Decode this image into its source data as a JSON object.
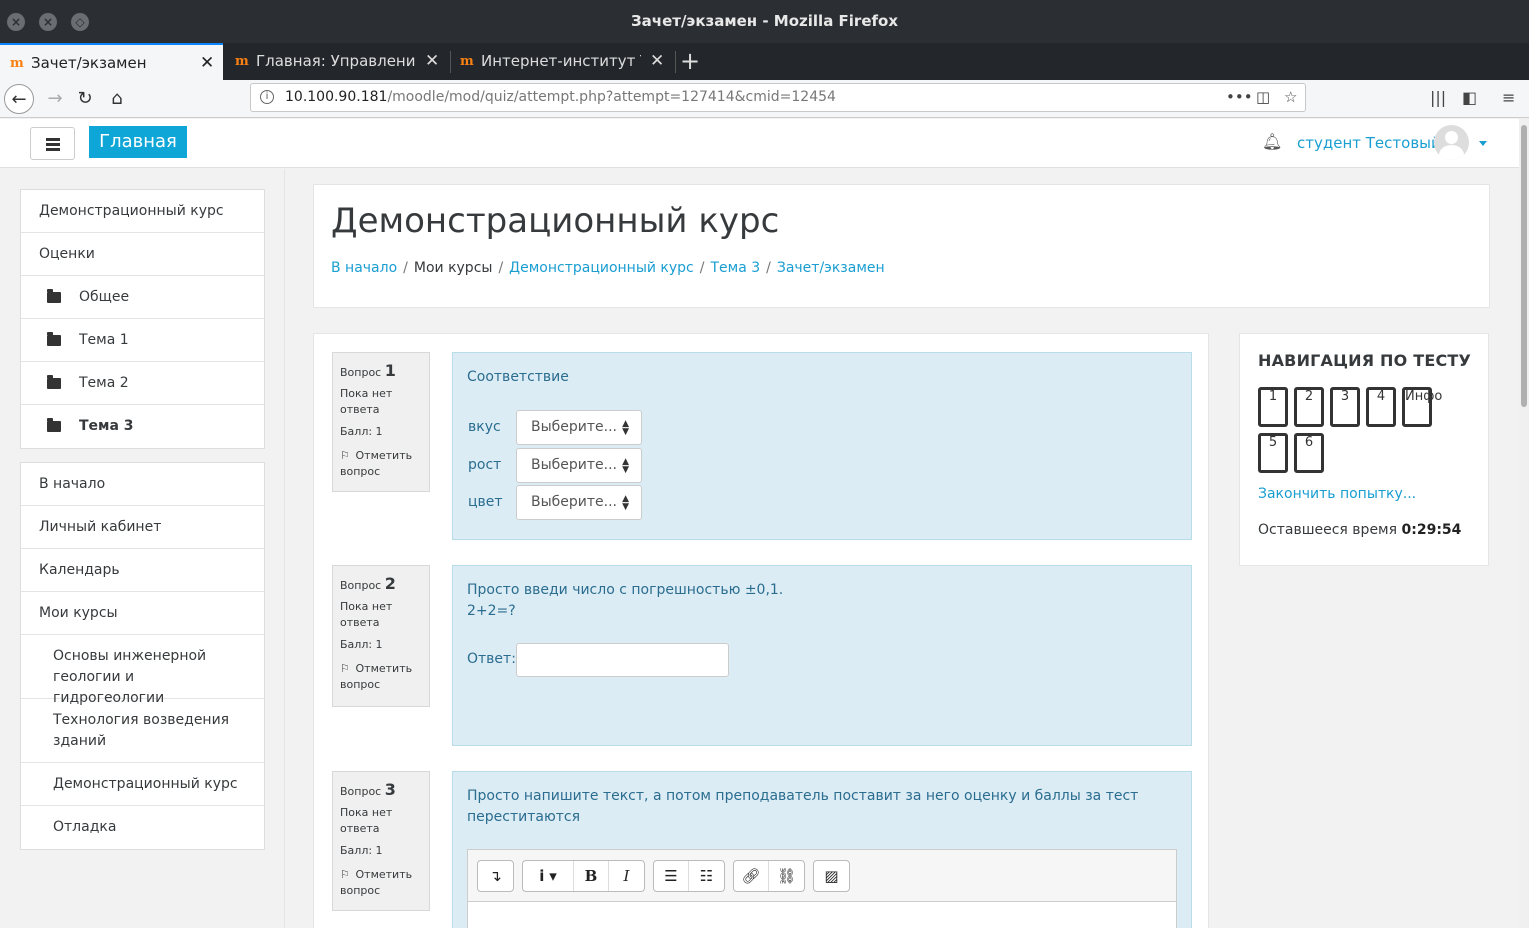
{
  "window": {
    "title": "Зачет/экзамен - Mozilla Firefox"
  },
  "tabs": [
    {
      "label": "Зачет/экзамен",
      "active": true
    },
    {
      "label": "Главная: Управление",
      "active": false
    },
    {
      "label": "Интернет-институт Ту",
      "active": false
    }
  ],
  "address": {
    "host": "10.100.90.181",
    "path": "/moodle/mod/quiz/attempt.php?attempt=127414&cmid=12454"
  },
  "header": {
    "home_label": "Главная",
    "user_name": "студент Тестовый"
  },
  "drawer": {
    "course_items": [
      {
        "label": "Демонстрационный курс"
      },
      {
        "label": "Оценки"
      },
      {
        "label": "Общее"
      },
      {
        "label": "Тема 1"
      },
      {
        "label": "Тема 2"
      },
      {
        "label": "Тема 3"
      }
    ],
    "site_items": [
      {
        "label": "В начало"
      },
      {
        "label": "Личный кабинет"
      },
      {
        "label": "Календарь"
      },
      {
        "label": "Мои курсы"
      },
      {
        "label": "Основы инженерной геологии и гидрогеологии"
      },
      {
        "label": "Технология возведения зданий"
      },
      {
        "label": "Демонстрационный курс"
      },
      {
        "label": "Отладка"
      }
    ]
  },
  "course": {
    "title": "Демонстрационный курс",
    "breadcrumb": [
      {
        "label": "В начало"
      },
      {
        "label": "Мои курсы"
      },
      {
        "label": "Демонстрационный курс"
      },
      {
        "label": "Тема 3"
      },
      {
        "label": "Зачет/экзамен"
      }
    ]
  },
  "questions": [
    {
      "label": "Вопрос",
      "number": "1",
      "status_line1": "Пока нет",
      "status_line2": "ответа",
      "grade": "Балл: 1",
      "flag_line1": "Отметить",
      "flag_line2": "вопрос",
      "text": "Соответствие",
      "matches": [
        {
          "label": "вкус",
          "value": "Выберите..."
        },
        {
          "label": "рост",
          "value": "Выберите..."
        },
        {
          "label": "цвет",
          "value": "Выберите..."
        }
      ]
    },
    {
      "label": "Вопрос",
      "number": "2",
      "status_line1": "Пока нет",
      "status_line2": "ответа",
      "grade": "Балл: 1",
      "flag_line1": "Отметить",
      "flag_line2": "вопрос",
      "text_line1": "Просто введи число с погрешностью ±0,1.",
      "text_line2": "2+2=?",
      "answer_label": "Ответ:",
      "answer_value": ""
    },
    {
      "label": "Вопрос",
      "number": "3",
      "status_line1": "Пока нет",
      "status_line2": "ответа",
      "grade": "Балл: 1",
      "flag_line1": "Отметить",
      "flag_line2": "вопрос",
      "text_line1": "Просто напишите текст, а потом преподаватель поставит за него оценку и баллы за тест",
      "text_line2": "переститаются"
    }
  ],
  "quiz_nav": {
    "title": "НАВИГАЦИЯ ПО ТЕСТУ",
    "buttons": [
      "1",
      "2",
      "3",
      "4",
      "Инфо",
      "5",
      "6"
    ],
    "finish_label": "Закончить попытку...",
    "time_label": "Оставшееся время",
    "time_value": "0:29:54"
  }
}
